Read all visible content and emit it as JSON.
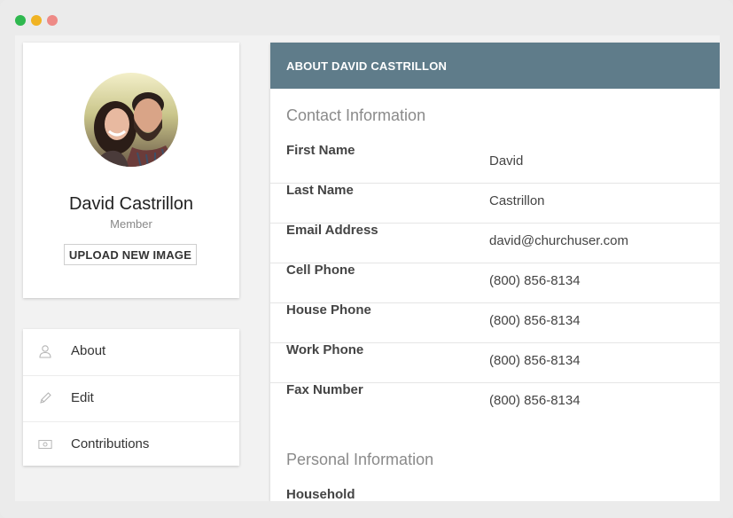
{
  "window": {
    "controls": [
      "close",
      "minimize",
      "zoom"
    ]
  },
  "profile": {
    "name": "David Castrillon",
    "role": "Member",
    "upload_label": "UPLOAD NEW IMAGE"
  },
  "nav": {
    "items": [
      {
        "label": "About",
        "icon": "person-icon"
      },
      {
        "label": "Edit",
        "icon": "pencil-icon"
      },
      {
        "label": "Contributions",
        "icon": "money-icon"
      }
    ]
  },
  "main": {
    "header_title": "ABOUT DAVID CASTRILLON",
    "contact": {
      "title": "Contact Information",
      "fields": [
        {
          "label": "First Name",
          "value": "David"
        },
        {
          "label": "Last Name",
          "value": "Castrillon"
        },
        {
          "label": "Email Address",
          "value": "david@churchuser.com"
        },
        {
          "label": "Cell Phone",
          "value": "(800) 856-8134"
        },
        {
          "label": "House Phone",
          "value": "(800) 856-8134"
        },
        {
          "label": "Work Phone",
          "value": "(800) 856-8134"
        },
        {
          "label": "Fax Number",
          "value": "(800) 856-8134"
        }
      ]
    },
    "personal": {
      "title": "Personal Information",
      "fields": [
        {
          "label": "Household",
          "value": ""
        }
      ]
    }
  },
  "colors": {
    "header_bg": "#5f7c8a",
    "dot_green": "#2fb84f",
    "dot_yellow": "#f0b323",
    "dot_red": "#ee8a86"
  }
}
